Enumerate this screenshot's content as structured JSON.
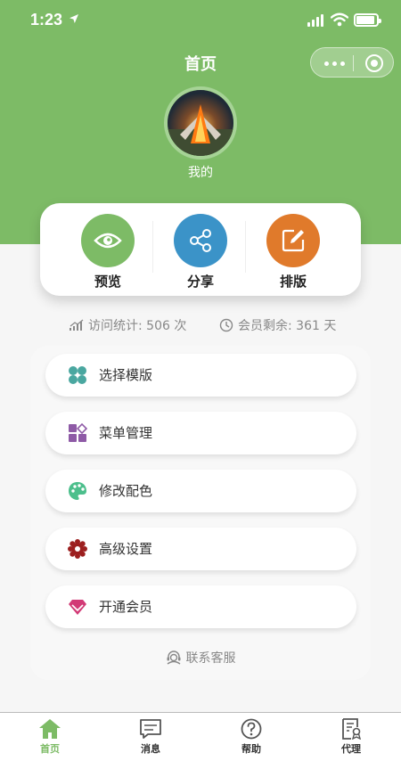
{
  "status_bar": {
    "time": "1:23"
  },
  "header": {
    "title": "首页",
    "bg_color": "#7dbb66"
  },
  "profile": {
    "name": "我的"
  },
  "actions": [
    {
      "label": "预览",
      "icon": "eye-icon",
      "color": "#7dbb66"
    },
    {
      "label": "分享",
      "icon": "share-icon",
      "color": "#3b93c8"
    },
    {
      "label": "排版",
      "icon": "edit-icon",
      "color": "#e07a2b"
    }
  ],
  "stats": {
    "visits": "访问统计: 506 次",
    "membership": "会员剩余: 361 天"
  },
  "menu": [
    {
      "label": "选择模版",
      "icon": "template-grid-icon",
      "color": "#4aa7a0"
    },
    {
      "label": "菜单管理",
      "icon": "menu-grid-icon",
      "color": "#8e5aa6"
    },
    {
      "label": "修改配色",
      "icon": "palette-icon",
      "color": "#4cbf8c"
    },
    {
      "label": "高级设置",
      "icon": "gear-icon",
      "color": "#9c1f1f"
    },
    {
      "label": "开通会员",
      "icon": "diamond-icon",
      "color": "#d23a76"
    }
  ],
  "customer_service": "联系客服",
  "tabs": [
    {
      "label": "首页",
      "icon": "home-icon",
      "active": true
    },
    {
      "label": "消息",
      "icon": "message-icon",
      "active": false
    },
    {
      "label": "帮助",
      "icon": "help-icon",
      "active": false
    },
    {
      "label": "代理",
      "icon": "agent-icon",
      "active": false
    }
  ]
}
